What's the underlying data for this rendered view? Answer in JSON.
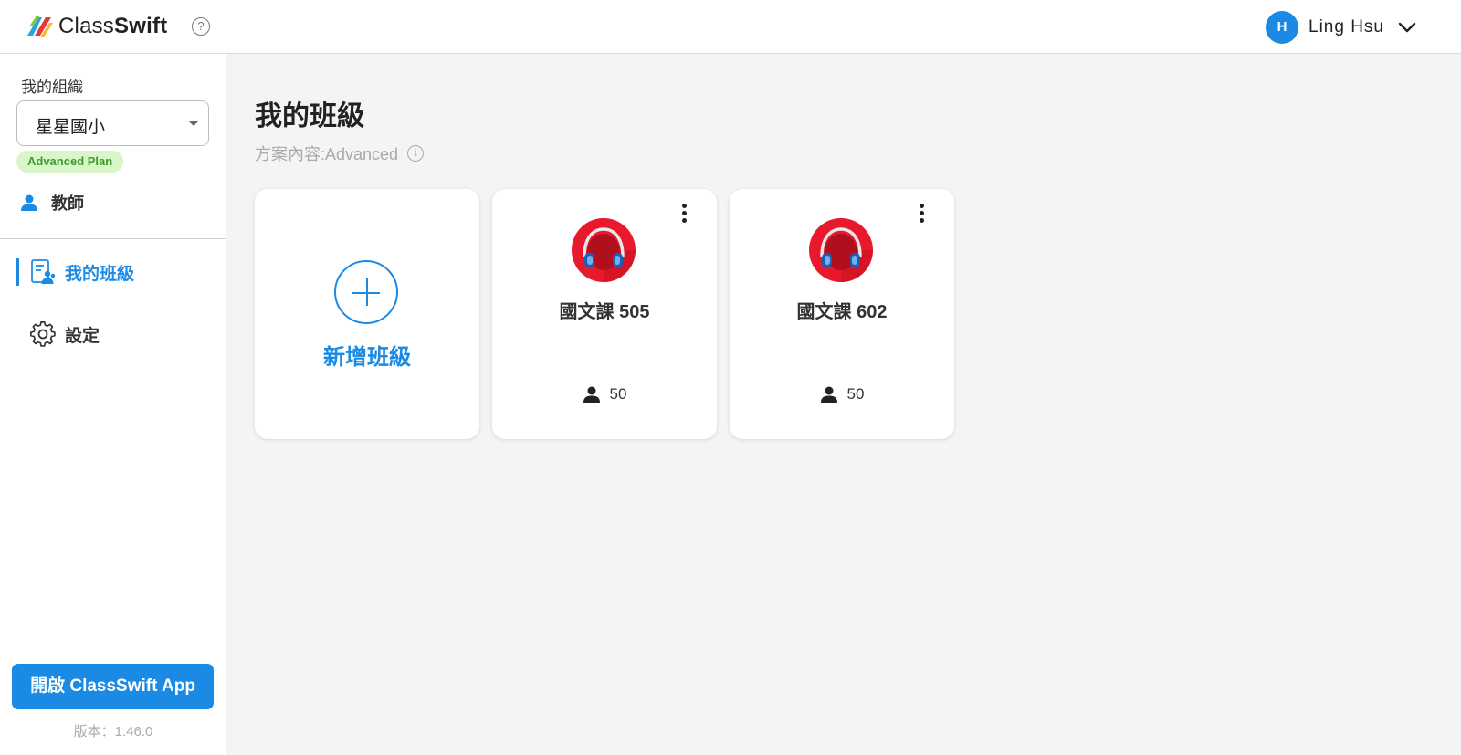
{
  "header": {
    "logo": {
      "class_text": "Class",
      "swift_text": "Swift"
    },
    "help_icon": "?",
    "user": {
      "initial": "H",
      "name": "Ling Hsu"
    }
  },
  "sidebar": {
    "org_label": "我的組織",
    "org_selected": "星星國小",
    "plan_badge": "Advanced Plan",
    "role_label": "教師",
    "nav": [
      {
        "label": "我的班級",
        "icon": "class-roster-icon",
        "active": true
      },
      {
        "label": "設定",
        "icon": "gear-icon",
        "active": false
      }
    ],
    "open_app_label": "開啟 ClassSwift App",
    "version": "版本：1.46.0"
  },
  "main": {
    "title": "我的班級",
    "plan_info": "方案內容:Advanced",
    "info_icon": "i",
    "add_label": "新增班級",
    "classes": [
      {
        "name": "國文課 505",
        "students": "50",
        "avatar": "headphones-avatar"
      },
      {
        "name": "國文課 602",
        "students": "50",
        "avatar": "headphones-avatar"
      }
    ]
  },
  "colors": {
    "accent": "#1a8ae5",
    "badge_bg": "#d9f6c9",
    "badge_text": "#3c9a2d",
    "avatar_red": "#e8192c"
  }
}
